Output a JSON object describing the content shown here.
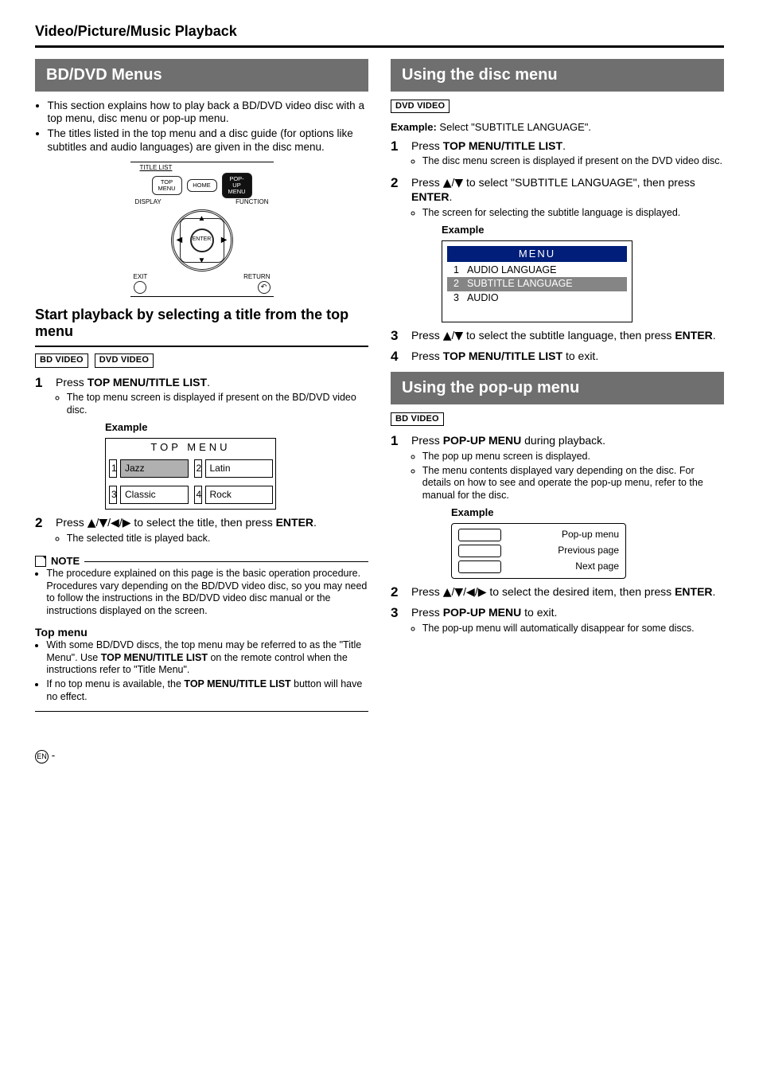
{
  "page_header": "Video/Picture/Music Playback",
  "left": {
    "section_title": "BD/DVD Menus",
    "intro_bullets": [
      "This section explains how to play back a BD/DVD video disc with a top menu, disc menu or pop-up menu.",
      "The titles listed in the top menu and a disc guide (for options like subtitles and audio languages) are given in the disc menu."
    ],
    "remote": {
      "title_list": "TITLE LIST",
      "top_menu": "TOP MENU",
      "home": "HOME",
      "popup_menu": "POP-UP MENU",
      "display": "DISPLAY",
      "function": "FUNCTION",
      "enter": "ENTER",
      "exit": "EXIT",
      "return": "RETURN"
    },
    "subhead": "Start playback by selecting a title from the top menu",
    "badges": [
      "BD VIDEO",
      "DVD VIDEO"
    ],
    "step1_line": [
      "Press ",
      "TOP MENU/TITLE LIST",
      "."
    ],
    "step1_sub": "The top menu screen is displayed if present on the BD/DVD video disc.",
    "example_label": "Example",
    "topmenu": {
      "title": "TOP MENU",
      "cells": [
        {
          "n": "1",
          "t": "Jazz",
          "sel": true
        },
        {
          "n": "2",
          "t": "Latin"
        },
        {
          "n": "3",
          "t": "Classic"
        },
        {
          "n": "4",
          "t": "Rock"
        }
      ]
    },
    "step2_line_pre": "Press ",
    "step2_line_post": " to select the title, then press ",
    "step2_enter": "ENTER",
    "step2_sub": "The selected title is played back.",
    "note_label": "NOTE",
    "note_bullet": "The procedure explained on this page is the basic operation procedure. Procedures vary depending on the BD/DVD video disc, so you may need to follow the instructions in the BD/DVD video disc manual or the instructions displayed on the screen.",
    "topmenu_heading": "Top menu",
    "topmenu_bullets_parts": [
      [
        "With some BD/DVD discs, the top menu may be referred to as the \"Title Menu\". Use ",
        "TOP MENU/TITLE LIST",
        " on the remote control when the instructions refer to \"Title Menu\"."
      ],
      [
        "If no top menu is available, the ",
        "TOP MENU/TITLE LIST",
        " button will have no effect."
      ]
    ]
  },
  "right": {
    "section_a_title": "Using the disc menu",
    "badges_a": [
      "DVD VIDEO"
    ],
    "example_line_label": "Example:",
    "example_line_text": " Select \"SUBTITLE LANGUAGE\".",
    "a_step1_line": [
      "Press ",
      "TOP MENU/TITLE LIST",
      "."
    ],
    "a_step1_sub": "The disc menu screen is displayed if present on the DVD video disc.",
    "a_step2_pre": "Press ",
    "a_step2_mid": " to select \"SUBTITLE LANGUAGE\", then press ",
    "a_step2_enter": "ENTER",
    "a_step2_sub": "The screen for selecting the subtitle language is displayed.",
    "example_label": "Example",
    "menu": {
      "title": "MENU",
      "rows": [
        {
          "n": "1",
          "t": "AUDIO LANGUAGE"
        },
        {
          "n": "2",
          "t": "SUBTITLE LANGUAGE",
          "sel": true
        },
        {
          "n": "3",
          "t": "AUDIO"
        }
      ]
    },
    "a_step3_pre": "Press ",
    "a_step3_post": " to select the subtitle language, then press ",
    "a_step3_enter": "ENTER",
    "a_step4_line": [
      "Press ",
      "TOP MENU/TITLE LIST",
      " to exit."
    ],
    "section_b_title": "Using the pop-up menu",
    "badges_b": [
      "BD VIDEO"
    ],
    "b_step1_line": [
      "Press ",
      "POP-UP MENU",
      " during playback."
    ],
    "b_step1_subs": [
      "The pop up menu screen is displayed.",
      "The menu contents displayed vary depending on the disc. For details on how to see and operate the pop-up menu, refer to the manual for the disc."
    ],
    "popup": {
      "rows": [
        "Pop-up menu",
        "Previous page",
        "Next page"
      ]
    },
    "b_step2_pre": "Press ",
    "b_step2_post": " to select the desired item, then press ",
    "b_step2_enter": "ENTER",
    "b_step3_line": [
      "Press ",
      "POP-UP MENU",
      " to exit."
    ],
    "b_step3_sub": "The pop-up menu will automatically disappear for some discs."
  },
  "glyphs": {
    "up": "▲",
    "down": "▼",
    "left": "◀",
    "right": "▶",
    "ret": "↶"
  },
  "footer_en": "EN",
  "footer_dash": " - "
}
